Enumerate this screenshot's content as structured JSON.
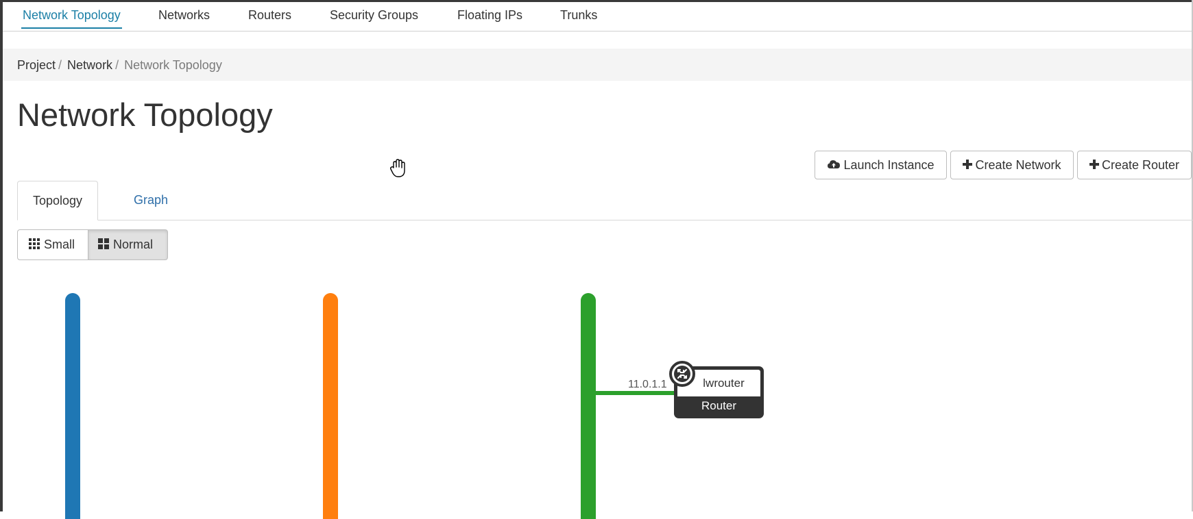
{
  "nav": {
    "tabs": [
      {
        "label": "Network Topology",
        "active": true
      },
      {
        "label": "Networks",
        "active": false
      },
      {
        "label": "Routers",
        "active": false
      },
      {
        "label": "Security Groups",
        "active": false
      },
      {
        "label": "Floating IPs",
        "active": false
      },
      {
        "label": "Trunks",
        "active": false
      }
    ],
    "accent_color": "#1b7fa6"
  },
  "breadcrumb": {
    "items": [
      "Project",
      "Network",
      "Network Topology"
    ],
    "separator": "/"
  },
  "page": {
    "title": "Network Topology"
  },
  "actions": {
    "launch_instance": {
      "label": "Launch Instance",
      "icon": "cloud-upload-icon"
    },
    "create_network": {
      "label": "Create Network",
      "icon": "plus-icon"
    },
    "create_router": {
      "label": "Create Router",
      "icon": "plus-icon"
    }
  },
  "view_tabs": {
    "topology": {
      "label": "Topology",
      "active": true
    },
    "graph": {
      "label": "Graph",
      "active": false
    }
  },
  "size_toggle": {
    "small": {
      "label": "Small",
      "icon": "th-grid-icon",
      "active": false
    },
    "normal": {
      "label": "Normal",
      "icon": "th-large-icon",
      "active": true
    }
  },
  "topology": {
    "networks": [
      {
        "color": "#1f77b4"
      },
      {
        "color": "#ff7f0e"
      },
      {
        "color": "#2ca02c"
      }
    ],
    "router": {
      "name": "lwrouter",
      "type_label": "Router",
      "icon": "router-icon",
      "port_ip": "11.0.1.1",
      "connected_network_color": "#2ca02c"
    }
  }
}
